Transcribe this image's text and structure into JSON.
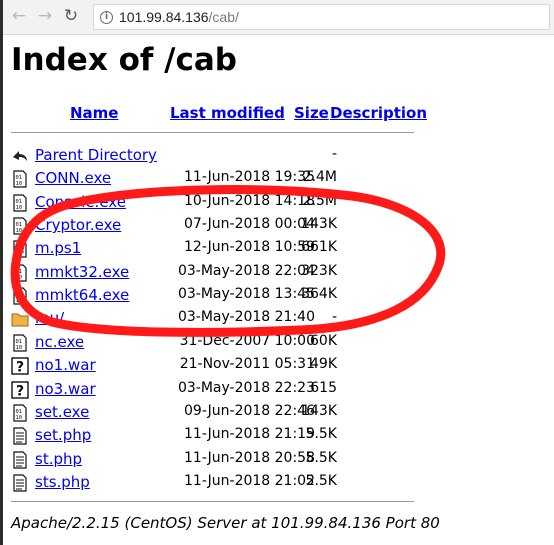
{
  "browser": {
    "url_host": "101.99.84.136",
    "url_path": "/cab/"
  },
  "page": {
    "title": "Index of /cab",
    "columns": {
      "name": "Name",
      "last_modified": "Last modified",
      "size": "Size",
      "description": "Description"
    },
    "entries": [
      {
        "name": "Parent Directory",
        "date": "",
        "size": "-",
        "icon": "back-icon"
      },
      {
        "name": "CONN.exe",
        "date": "11-Jun-2018 19:35",
        "size": "2.4M",
        "icon": "binary-file-icon"
      },
      {
        "name": "Console.exe",
        "date": "10-Jun-2018 14:18",
        "size": "2.5M",
        "icon": "binary-file-icon"
      },
      {
        "name": "Cryptor.exe",
        "date": "07-Jun-2018 00:04",
        "size": "143K",
        "icon": "binary-file-icon"
      },
      {
        "name": "m.ps1",
        "date": "12-Jun-2018 10:59",
        "size": "661K",
        "icon": "text-file-icon"
      },
      {
        "name": "mmkt32.exe",
        "date": "03-May-2018 22:04",
        "size": "323K",
        "icon": "binary-file-icon"
      },
      {
        "name": "mmkt64.exe",
        "date": "03-May-2018 13:45",
        "size": "364K",
        "icon": "binary-file-icon"
      },
      {
        "name": "mu/",
        "date": "03-May-2018 21:40",
        "size": "-",
        "icon": "folder-icon"
      },
      {
        "name": "nc.exe",
        "date": "31-Dec-2007 10:00",
        "size": "60K",
        "icon": "binary-file-icon"
      },
      {
        "name": "no1.war",
        "date": "21-Nov-2011 05:31",
        "size": "49K",
        "icon": "unknown-file-icon"
      },
      {
        "name": "no3.war",
        "date": "03-May-2018 22:23",
        "size": "615",
        "icon": "unknown-file-icon"
      },
      {
        "name": "set.exe",
        "date": "09-Jun-2018 22:46",
        "size": "143K",
        "icon": "binary-file-icon"
      },
      {
        "name": "set.php",
        "date": "11-Jun-2018 21:19",
        "size": "5.5K",
        "icon": "text-file-icon"
      },
      {
        "name": "st.php",
        "date": "11-Jun-2018 20:58",
        "size": "5.5K",
        "icon": "text-file-icon"
      },
      {
        "name": "sts.php",
        "date": "11-Jun-2018 21:02",
        "size": "5.5K",
        "icon": "text-file-icon"
      }
    ],
    "footer": "Apache/2.2.15 (CentOS) Server at 101.99.84.136 Port 80"
  },
  "colors": {
    "link": "#0000ee",
    "annotation": "#ff1a1a"
  }
}
